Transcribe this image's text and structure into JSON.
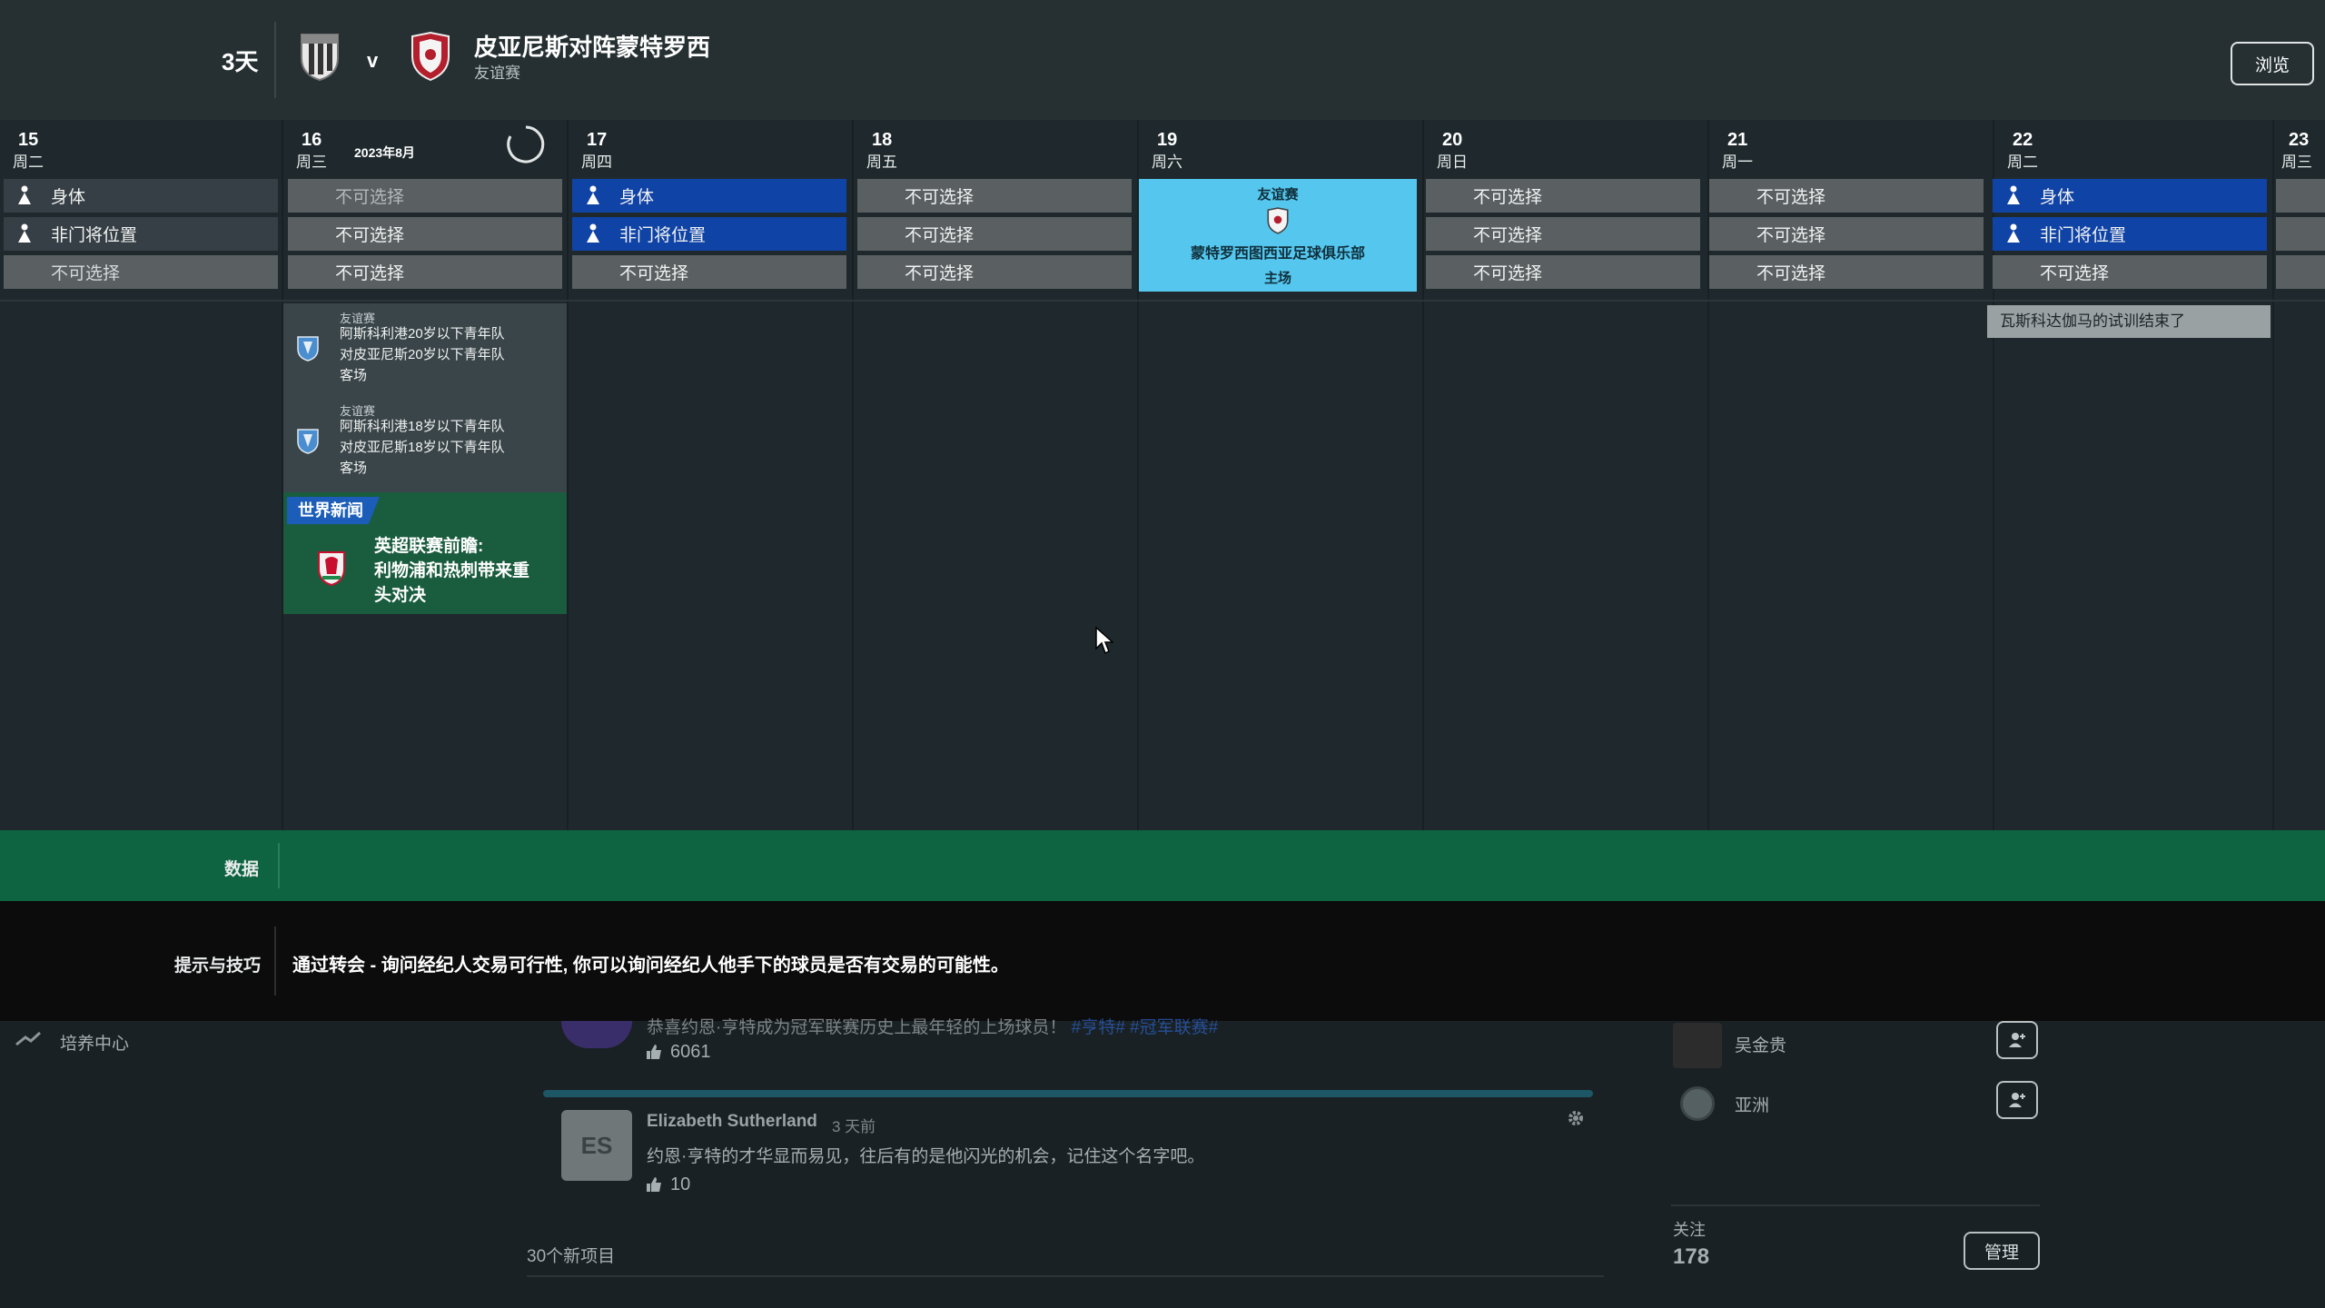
{
  "header": {
    "days_left": "3天",
    "vs": "v",
    "match_title": "皮亚尼斯对阵蒙特罗西",
    "match_subtitle": "友谊赛",
    "browse_label": "浏览"
  },
  "calendar": {
    "month_label": "2023年8月",
    "days": [
      {
        "num": "15",
        "weekday": "周二"
      },
      {
        "num": "16",
        "weekday": "周三"
      },
      {
        "num": "17",
        "weekday": "周四"
      },
      {
        "num": "18",
        "weekday": "周五"
      },
      {
        "num": "19",
        "weekday": "周六"
      },
      {
        "num": "20",
        "weekday": "周日"
      },
      {
        "num": "21",
        "weekday": "周一"
      },
      {
        "num": "22",
        "weekday": "周二"
      },
      {
        "num": "23",
        "weekday": "周三"
      }
    ],
    "slot_physical": "身体",
    "slot_position": "非门将位置",
    "slot_unavailable": "不可选择",
    "friendly": {
      "type": "友谊赛",
      "opponent": "蒙特罗西图西亚足球俱乐部",
      "venue": "主场"
    },
    "events16": [
      {
        "type": "友谊赛",
        "line1": "阿斯科利港20岁以下青年队",
        "line2": "对皮亚尼斯20岁以下青年队",
        "venue": "客场"
      },
      {
        "type": "友谊赛",
        "line1": "阿斯科利港18岁以下青年队",
        "line2": "对皮亚尼斯18岁以下青年队",
        "venue": "客场"
      }
    ],
    "news": {
      "tag": "世界新闻",
      "line1": "英超联赛前瞻:",
      "line2": "利物浦和热刺带来重",
      "line3": "头对决"
    },
    "trial_note": "瓦斯科达伽马的试训结束了"
  },
  "data_label": "数据",
  "tips": {
    "label": "提示与技巧",
    "text": "通过转会 - 询问经纪人交易可行性, 你可以询问经纪人他手下的球员是否有交易的可能性。"
  },
  "background": {
    "sidebar_item": "培养中心",
    "feed_text_top": "恭喜约恩·亨特成为冠军联赛历史上最年轻的上场球员！",
    "feed_tags": "#亨特# #冠军联赛#",
    "likes1": "6061",
    "comment_avatar": "ES",
    "comment_author": "Elizabeth Sutherland",
    "comment_time": "3 天前",
    "comment_text": "约恩·亨特的才华显而易见，往后有的是他闪光的机会，记住这个名字吧。",
    "likes2": "10",
    "new_items": "30个新项目",
    "follow1": "吴金贵",
    "follow2": "亚洲",
    "follow_label": "关注",
    "follow_count": "178",
    "manage_label": "管理"
  },
  "colors": {
    "accent_blue": "#1043a6",
    "friendly_cyan": "#55c6ee",
    "data_green": "#0e6340"
  }
}
